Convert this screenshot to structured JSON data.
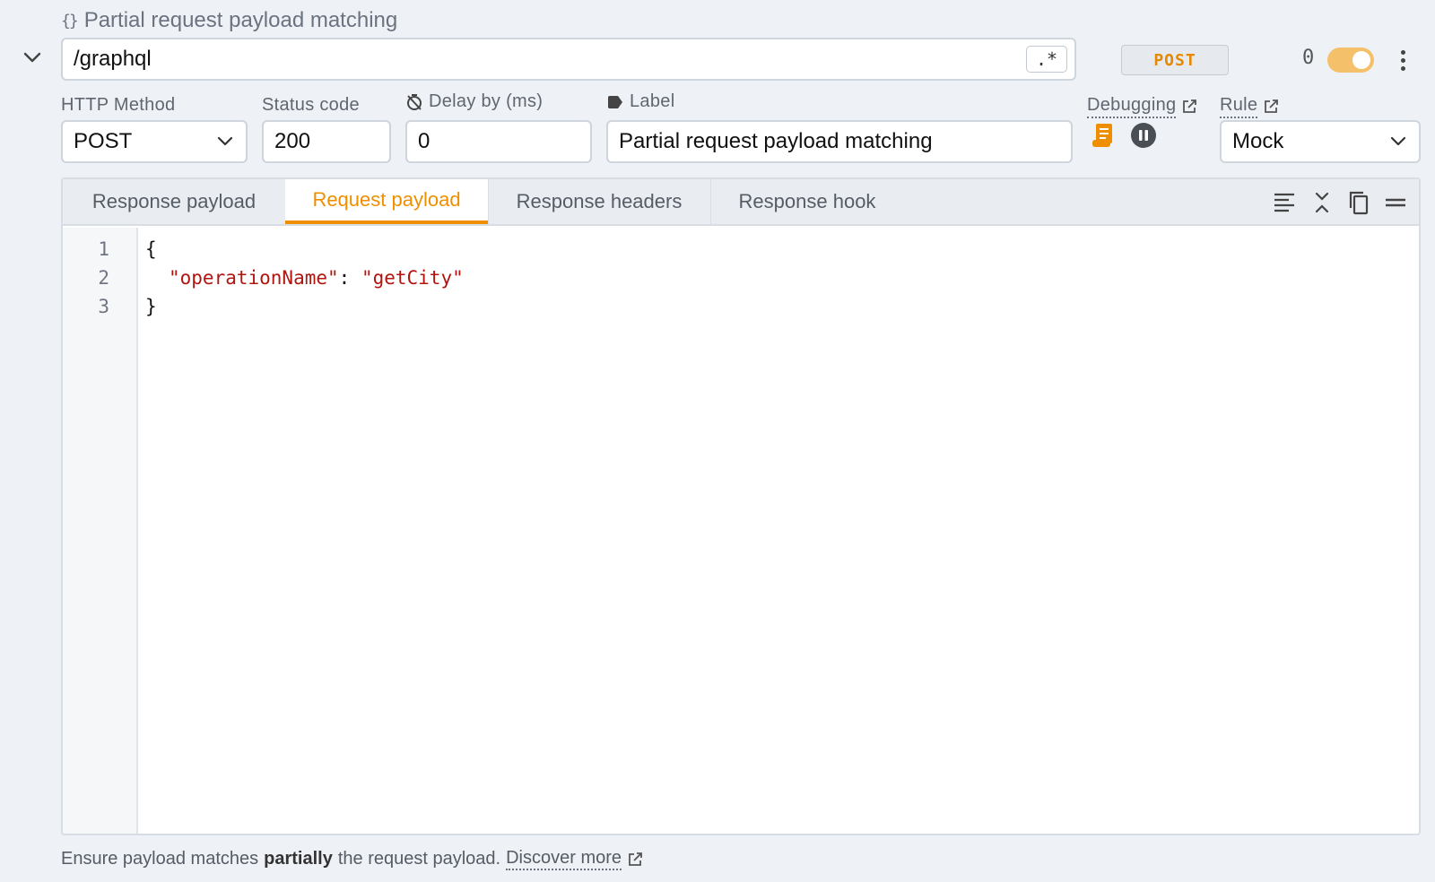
{
  "rule": {
    "title": "Partial request payload matching",
    "url": "/graphql",
    "regex_label": ".*",
    "method_badge": "POST",
    "hit_count": "0",
    "enabled": true
  },
  "fields": {
    "http_method": {
      "label": "HTTP Method",
      "value": "POST"
    },
    "status_code": {
      "label": "Status code",
      "value": "200"
    },
    "delay": {
      "label": "Delay by (ms)",
      "value": "0"
    },
    "label": {
      "label": "Label",
      "value": "Partial request payload matching"
    },
    "debugging": {
      "label": "Debugging"
    },
    "rule_type": {
      "label": "Rule",
      "value": "Mock"
    }
  },
  "tabs": [
    {
      "label": "Response payload",
      "active": false
    },
    {
      "label": "Request payload",
      "active": true
    },
    {
      "label": "Response headers",
      "active": false
    },
    {
      "label": "Response hook",
      "active": false
    }
  ],
  "editor": {
    "line_numbers": [
      "1",
      "2",
      "3"
    ],
    "lines": {
      "l1": "{",
      "l2_key": "\"operationName\"",
      "l2_colon": ": ",
      "l2_value": "\"getCity\"",
      "l3": "}"
    }
  },
  "footer": {
    "text_before": "Ensure payload matches",
    "bold": "partially",
    "text_after": "the request payload.",
    "link": "Discover more"
  },
  "colors": {
    "accent": "#ef8f00",
    "toggle_on": "#f4c06a",
    "string": "#b0150f"
  }
}
